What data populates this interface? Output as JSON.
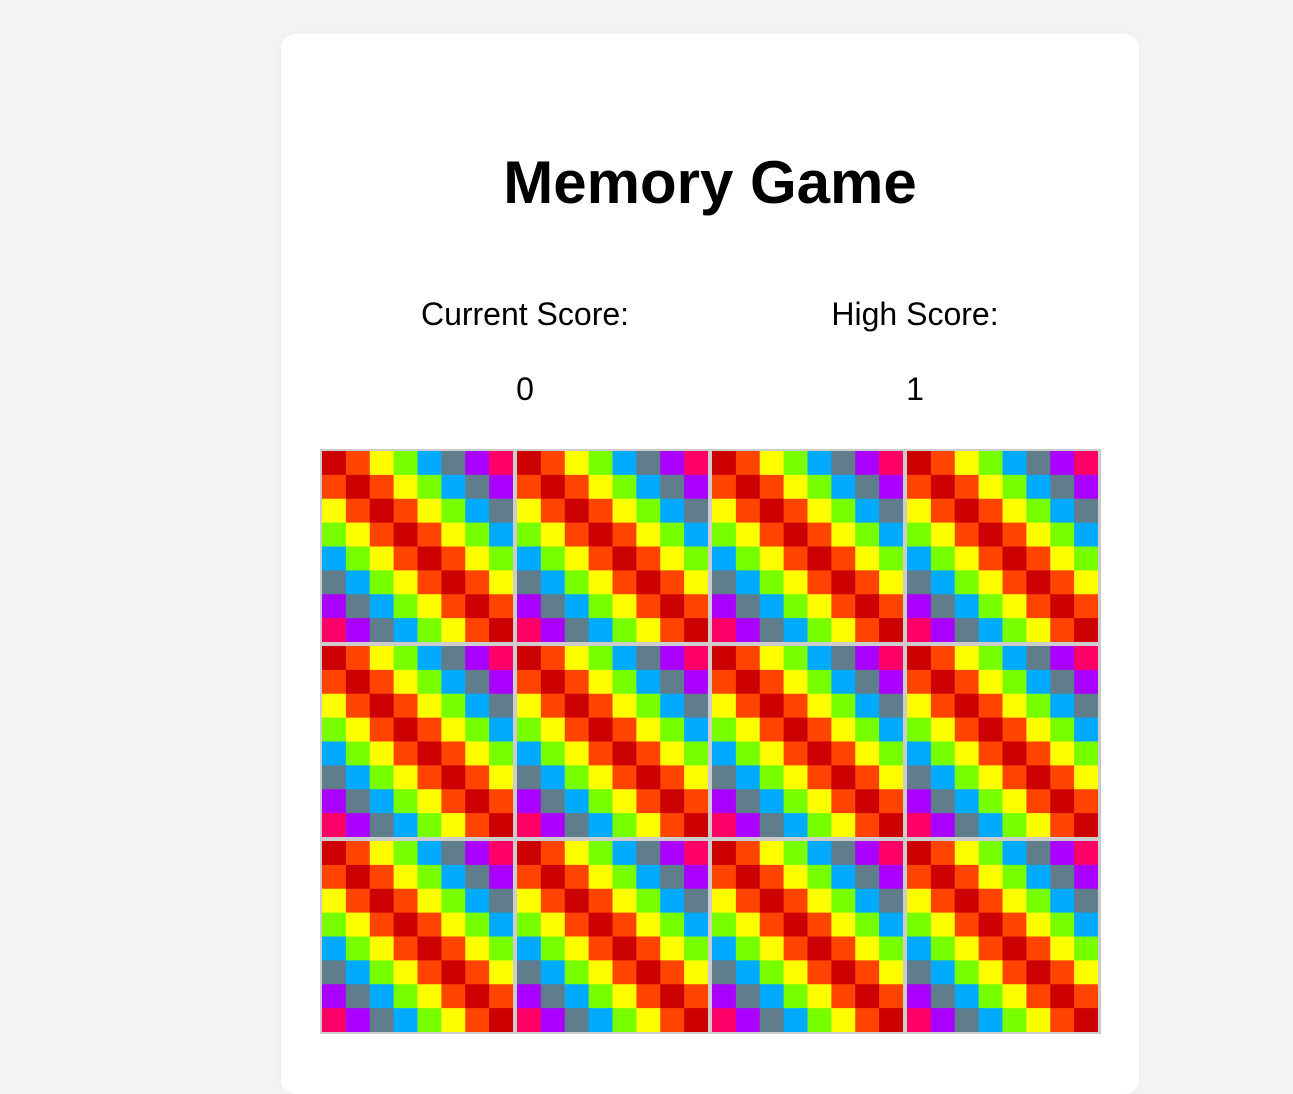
{
  "game": {
    "title": "Memory Game",
    "current_score_label": "Current Score:",
    "current_score_value": "0",
    "high_score_label": "High Score:",
    "high_score_value": "1"
  },
  "board": {
    "rows": 3,
    "columns": 4,
    "tiles": [
      {
        "state": "face-down"
      },
      {
        "state": "face-down"
      },
      {
        "state": "face-down"
      },
      {
        "state": "face-down"
      },
      {
        "state": "face-down"
      },
      {
        "state": "face-down"
      },
      {
        "state": "face-down"
      },
      {
        "state": "face-down"
      },
      {
        "state": "face-down"
      },
      {
        "state": "face-down"
      },
      {
        "state": "face-down"
      },
      {
        "state": "face-down"
      }
    ],
    "card_back_palette": [
      "#ff0066",
      "#aa00ff",
      "#607d8b",
      "#00aaff",
      "#77ff00",
      "#ffff00",
      "#ff4400",
      "#cc0000"
    ]
  }
}
